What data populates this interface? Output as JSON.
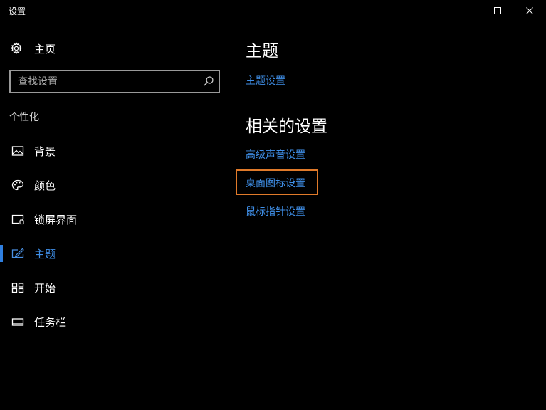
{
  "window": {
    "title": "设置"
  },
  "sidebar": {
    "home_label": "主页",
    "search": {
      "placeholder": "查找设置"
    },
    "section_title": "个性化",
    "items": [
      {
        "label": "背景",
        "icon": "image-icon"
      },
      {
        "label": "颜色",
        "icon": "palette-icon"
      },
      {
        "label": "锁屏界面",
        "icon": "lockscreen-icon"
      },
      {
        "label": "主题",
        "icon": "theme-brush-icon",
        "active": true
      },
      {
        "label": "开始",
        "icon": "start-tiles-icon"
      },
      {
        "label": "任务栏",
        "icon": "taskbar-icon"
      }
    ]
  },
  "main": {
    "theme_heading": "主题",
    "theme_settings_link": "主题设置",
    "related_heading": "相关的设置",
    "related_links": [
      "高级声音设置",
      "桌面图标设置",
      "鼠标指针设置"
    ]
  },
  "colors": {
    "accent": "#3f8fe8",
    "highlight_border": "#e07a2a",
    "background": "#000000"
  }
}
